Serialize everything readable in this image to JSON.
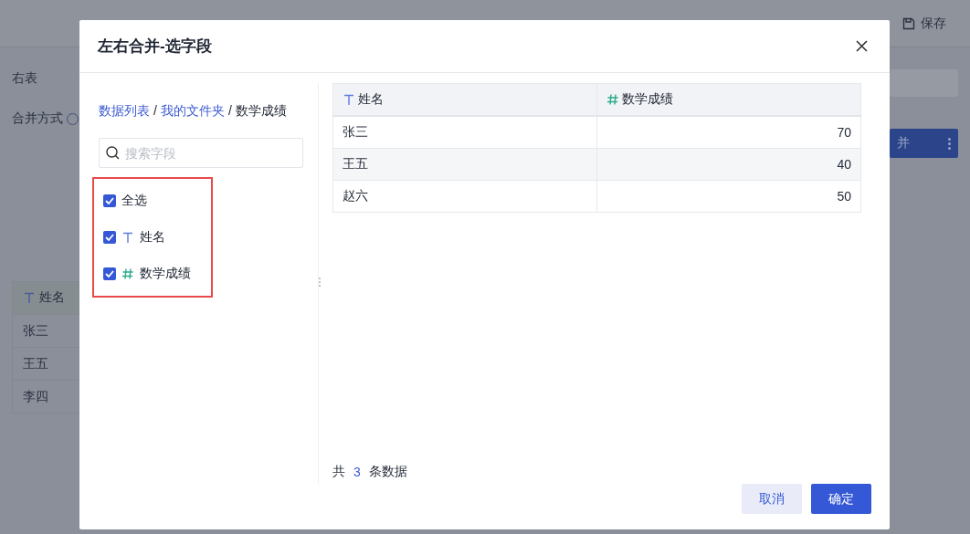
{
  "background": {
    "toolbar": [
      {
        "kind": "save",
        "label": "保存"
      }
    ],
    "right_table_label": "右表",
    "merge_mode_label": "合并方式",
    "merge_button": "并",
    "table": {
      "column": "姓名",
      "rows": [
        "张三",
        "王五",
        "李四"
      ]
    }
  },
  "dialog": {
    "title": "左右合并-选字段",
    "breadcrumb": [
      {
        "label": "数据列表",
        "link": true
      },
      {
        "separator": "/",
        "label": "我的文件夹",
        "link": true
      },
      {
        "separator": "/",
        "label": "数学成绩",
        "link": false
      }
    ],
    "search": {
      "placeholder": "搜索字段"
    },
    "fields": [
      {
        "kind": "all",
        "label": "全选",
        "checked": true
      },
      {
        "kind": "text",
        "label": "姓名",
        "checked": true
      },
      {
        "kind": "number",
        "label": "数学成绩",
        "checked": true
      }
    ],
    "preview": {
      "columns": [
        {
          "kind": "text",
          "label": "姓名"
        },
        {
          "kind": "number",
          "label": "数学成绩"
        }
      ],
      "rows": [
        [
          "张三",
          "70"
        ],
        [
          "王五",
          "40"
        ],
        [
          "赵六",
          "50"
        ]
      ]
    },
    "footer": {
      "prefix": "共",
      "count": "3",
      "suffix": "条数据"
    },
    "buttons": [
      {
        "kind": "secondary",
        "label": "取消"
      },
      {
        "kind": "primary",
        "label": "确定"
      }
    ]
  }
}
